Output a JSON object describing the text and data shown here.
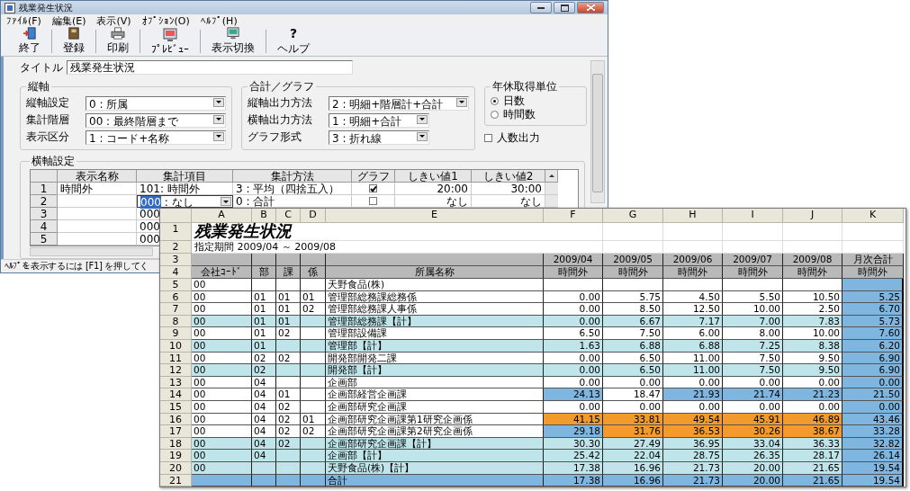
{
  "window": {
    "title": "残業発生状況"
  },
  "menu": [
    "ﾌｧｲﾙ(F)",
    "編集(E)",
    "表示(V)",
    "ｵﾌﾟｼｮﾝ(O)",
    "ﾍﾙﾌﾟ(H)"
  ],
  "toolbar": [
    {
      "label": "終了"
    },
    {
      "label": "登録"
    },
    {
      "label": "印刷"
    },
    {
      "label": "ﾌﾟﾚﾋﾞｭｰ"
    },
    {
      "label": "表示切換"
    },
    {
      "label": "ヘルプ",
      "glyph": "?"
    }
  ],
  "title_field": {
    "label": "タイトル",
    "value": "残業発生状況"
  },
  "vertical_axis": {
    "label": "縦軸",
    "fields": [
      {
        "label": "縦軸設定",
        "value": "0 : 所属"
      },
      {
        "label": "集計階層",
        "value": "00 : 最終階層まで"
      },
      {
        "label": "表示区分",
        "value": "1 : コード+名称"
      }
    ]
  },
  "totals_graph": {
    "label": "合計／グラフ",
    "fields": [
      {
        "label": "縦軸出力方法",
        "value": "2 : 明細+階層計+合計"
      },
      {
        "label": "横軸出力方法",
        "value": "1 : 明細+合計"
      },
      {
        "label": "グラフ形式",
        "value": "3 : 折れ線"
      }
    ]
  },
  "leave_unit": {
    "label": "年休取得単位",
    "options": [
      {
        "label": "日数",
        "selected": true
      },
      {
        "label": "時間数",
        "selected": false
      }
    ]
  },
  "headcount_output": {
    "label": "人数出力",
    "checked": false
  },
  "horizontal_axis": {
    "label": "横軸設定",
    "columns": [
      "表示名称",
      "集計項目",
      "集計方法",
      "グラフ",
      "しきい値1",
      "しきい値2"
    ],
    "rows": [
      {
        "row": "1",
        "name": "時間外",
        "item_code": "101",
        "item_name": ": 時間外",
        "method": "3 : 平均（四捨五入）",
        "graph": true,
        "threshold_1": "20:00",
        "threshold_2": "30:00",
        "editing": false
      },
      {
        "row": "2",
        "item_code": "000",
        "item_name": ": なし",
        "method": "0 : 合計",
        "graph": false,
        "threshold_1": "なし",
        "threshold_2": "なし",
        "editing": true
      },
      {
        "row": "3",
        "item_code": "000",
        "editing": false
      },
      {
        "row": "4",
        "item_code": "000",
        "editing": false
      },
      {
        "row": "5",
        "item_code": "000",
        "editing": false
      }
    ]
  },
  "status_bar": "ﾍﾙﾌﾟを表示するには [F1] を押してく",
  "sheet": {
    "columns": [
      "A",
      "B",
      "C",
      "D",
      "E",
      "F",
      "G",
      "H",
      "I",
      "J",
      "K"
    ],
    "row_numbers": [
      "1",
      "2",
      "3",
      "4"
    ],
    "title": "残業発生状況",
    "period": "指定期間  2009/04 ～ 2009/08",
    "months": [
      "2009/04",
      "2009/05",
      "2009/06",
      "2009/07",
      "2009/08",
      "月次合計"
    ],
    "headers": [
      "会社ｺｰﾄﾞ",
      "部",
      "課",
      "係",
      "所属名称"
    ],
    "measures": [
      "時間外",
      "時間外",
      "時間外",
      "時間外",
      "時間外",
      "時間外"
    ],
    "rows": [
      {
        "row": "5",
        "kind": "detail",
        "codes": [
          "00"
        ],
        "name": "天野食品(株)"
      },
      {
        "row": "6",
        "kind": "detail",
        "codes": [
          "00",
          "01",
          "01",
          "01"
        ],
        "name": "管理部総務課総務係",
        "values": [
          {
            "text": "0.00"
          },
          {
            "text": "5.75"
          },
          {
            "text": "4.50"
          },
          {
            "text": "5.50"
          },
          {
            "text": "10.50"
          }
        ],
        "total": "5.25"
      },
      {
        "row": "7",
        "kind": "detail",
        "codes": [
          "00",
          "01",
          "01",
          "02"
        ],
        "name": "管理部総務課人事係",
        "values": [
          {
            "text": "0.00"
          },
          {
            "text": "8.50"
          },
          {
            "text": "12.50"
          },
          {
            "text": "10.00"
          },
          {
            "text": "2.50"
          }
        ],
        "total": "6.70"
      },
      {
        "row": "8",
        "kind": "subtotal",
        "codes": [
          "00",
          "01",
          "01"
        ],
        "name": "管理部総務課【計】",
        "values": [
          {
            "text": "0.00"
          },
          {
            "text": "6.67"
          },
          {
            "text": "7.17"
          },
          {
            "text": "7.00"
          },
          {
            "text": "7.83"
          }
        ],
        "total": "5.73"
      },
      {
        "row": "9",
        "kind": "detail",
        "codes": [
          "00",
          "01",
          "02"
        ],
        "name": "管理部設備課",
        "values": [
          {
            "text": "6.50"
          },
          {
            "text": "7.50"
          },
          {
            "text": "6.00"
          },
          {
            "text": "8.00"
          },
          {
            "text": "10.00"
          }
        ],
        "total": "7.60"
      },
      {
        "row": "10",
        "kind": "subtotal",
        "codes": [
          "00",
          "01"
        ],
        "name": "管理部【計】",
        "values": [
          {
            "text": "1.63"
          },
          {
            "text": "6.88"
          },
          {
            "text": "6.88"
          },
          {
            "text": "7.25"
          },
          {
            "text": "8.38"
          }
        ],
        "total": "6.20"
      },
      {
        "row": "11",
        "kind": "detail",
        "codes": [
          "00",
          "02",
          "02"
        ],
        "name": "開発部開発二課",
        "values": [
          {
            "text": "0.00"
          },
          {
            "text": "6.50"
          },
          {
            "text": "11.00"
          },
          {
            "text": "7.50"
          },
          {
            "text": "9.50"
          }
        ],
        "total": "6.90"
      },
      {
        "row": "12",
        "kind": "subtotal",
        "codes": [
          "00",
          "02"
        ],
        "name": "開発部【計】",
        "values": [
          {
            "text": "0.00"
          },
          {
            "text": "6.50"
          },
          {
            "text": "11.00"
          },
          {
            "text": "7.50"
          },
          {
            "text": "9.50"
          }
        ],
        "total": "6.90"
      },
      {
        "row": "13",
        "kind": "detail",
        "codes": [
          "00",
          "04"
        ],
        "name": "企画部",
        "values": [
          {
            "text": "0.00"
          },
          {
            "text": "0.00"
          },
          {
            "text": "0.00"
          },
          {
            "text": "0.00"
          },
          {
            "text": "0.00"
          }
        ],
        "total": "0.00"
      },
      {
        "row": "14",
        "kind": "detail",
        "codes": [
          "00",
          "04",
          "01"
        ],
        "name": "企画部経営企画課",
        "values": [
          {
            "text": "24.13",
            "color": "#7fb6e0"
          },
          {
            "text": "18.47"
          },
          {
            "text": "21.93",
            "color": "#7fb6e0"
          },
          {
            "text": "21.74",
            "color": "#7fb6e0"
          },
          {
            "text": "21.23",
            "color": "#7fb6e0"
          }
        ],
        "total": "21.50"
      },
      {
        "row": "15",
        "kind": "detail",
        "codes": [
          "00",
          "04",
          "02"
        ],
        "name": "企画部研究企画課",
        "values": [
          {
            "text": "0.00"
          },
          {
            "text": "0.00"
          },
          {
            "text": "0.00"
          },
          {
            "text": "0.00"
          },
          {
            "text": "0.00"
          }
        ],
        "total": "0.00"
      },
      {
        "row": "16",
        "kind": "detail",
        "codes": [
          "00",
          "04",
          "02",
          "01"
        ],
        "name": "企画部研究企画課第1研究企画係",
        "values": [
          {
            "text": "41.15",
            "color": "#f39a2c"
          },
          {
            "text": "33.81",
            "color": "#f39a2c"
          },
          {
            "text": "49.54",
            "color": "#f39a2c"
          },
          {
            "text": "45.91",
            "color": "#f39a2c"
          },
          {
            "text": "46.89",
            "color": "#f39a2c"
          }
        ],
        "total": "43.46"
      },
      {
        "row": "17",
        "kind": "detail",
        "codes": [
          "00",
          "04",
          "02",
          "02"
        ],
        "name": "企画部研究企画課第2研究企画係",
        "values": [
          {
            "text": "29.18",
            "color": "#7fb6e0"
          },
          {
            "text": "31.76",
            "color": "#f39a2c"
          },
          {
            "text": "36.53",
            "color": "#f39a2c"
          },
          {
            "text": "30.26",
            "color": "#f39a2c"
          },
          {
            "text": "38.67",
            "color": "#f39a2c"
          }
        ],
        "total": "33.28"
      },
      {
        "row": "18",
        "kind": "subtotal",
        "codes": [
          "00",
          "04",
          "02"
        ],
        "name": "企画部研究企画課【計】",
        "values": [
          {
            "text": "30.30"
          },
          {
            "text": "27.49"
          },
          {
            "text": "36.95"
          },
          {
            "text": "33.04"
          },
          {
            "text": "36.33"
          }
        ],
        "total": "32.82"
      },
      {
        "row": "19",
        "kind": "subtotal",
        "codes": [
          "00",
          "04"
        ],
        "name": "企画部【計】",
        "values": [
          {
            "text": "25.42"
          },
          {
            "text": "22.04"
          },
          {
            "text": "28.75"
          },
          {
            "text": "26.35"
          },
          {
            "text": "28.17"
          }
        ],
        "total": "26.14"
      },
      {
        "row": "20",
        "kind": "subtotal",
        "codes": [
          "00"
        ],
        "name": "天野食品(株)【計】",
        "values": [
          {
            "text": "17.38"
          },
          {
            "text": "16.96"
          },
          {
            "text": "21.73"
          },
          {
            "text": "20.00"
          },
          {
            "text": "21.65"
          }
        ],
        "total": "19.54"
      },
      {
        "row": "21",
        "kind": "total",
        "name": "合計",
        "values": [
          {
            "text": "17.38"
          },
          {
            "text": "16.96"
          },
          {
            "text": "21.73"
          },
          {
            "text": "20.00"
          },
          {
            "text": "21.65"
          }
        ],
        "total": "19.54"
      }
    ]
  }
}
